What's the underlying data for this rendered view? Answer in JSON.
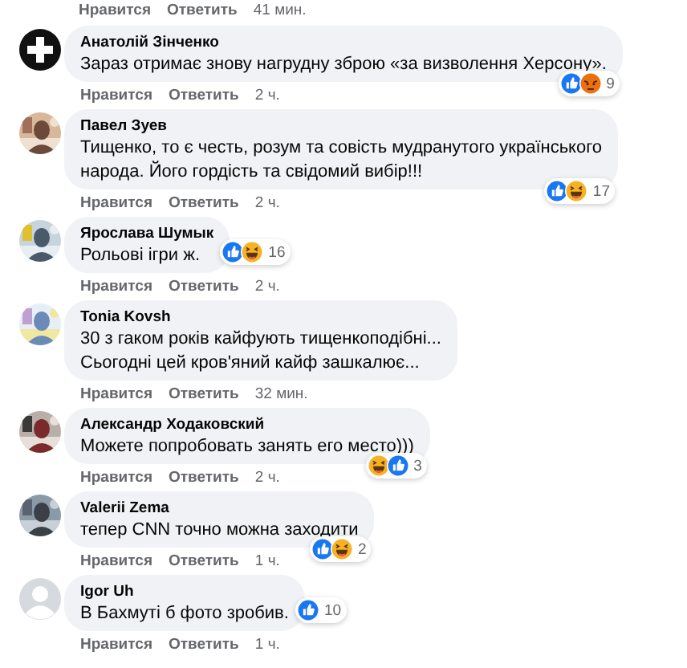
{
  "top_actions": {
    "like": "Нравится",
    "reply": "Ответить",
    "time": "41 мин."
  },
  "comments": [
    {
      "avatar": {
        "kind": "icon"
      },
      "author": "Анатолій Зінченко",
      "lines": [
        "Зараз отримає знову нагрудну зброю «за визволення Херсону»."
      ],
      "reactions": {
        "beside": false,
        "emojis": [
          {
            "kind": "like"
          },
          {
            "kind": "angry"
          }
        ],
        "count": "9"
      },
      "actions": {
        "like": "Нравится",
        "reply": "Ответить",
        "time": "2 ч."
      }
    },
    {
      "avatar": {
        "kind": "picture"
      },
      "author": "Павел Зуев",
      "lines": [
        "Тищенко, то є честь, розум та совість мудранутого українського",
        "народа. Його гордість та свідомий вибір!!!"
      ],
      "reactions": {
        "beside": false,
        "emojis": [
          {
            "kind": "like"
          },
          {
            "kind": "haha"
          }
        ],
        "count": "17"
      },
      "actions": {
        "like": "Нравится",
        "reply": "Ответить",
        "time": "2 ч."
      }
    },
    {
      "avatar": {
        "kind": "picture"
      },
      "author": "Ярослава Шумык",
      "lines": [
        "Рольові ігри ж."
      ],
      "reactions": {
        "beside": true,
        "emojis": [
          {
            "kind": "like"
          },
          {
            "kind": "haha"
          }
        ],
        "count": "16"
      },
      "actions": {
        "like": "Нравится",
        "reply": "Ответить",
        "time": "2 ч."
      }
    },
    {
      "avatar": {
        "kind": "picture"
      },
      "author": "Tonia Kovsh",
      "lines": [
        "30 з гаком років кайфують тищенкоподібні...",
        "Сьогодні цей кров'яний кайф зашкалює..."
      ],
      "actions": {
        "like": "Нравится",
        "reply": "Ответить",
        "time": "32 мин."
      }
    },
    {
      "avatar": {
        "kind": "picture"
      },
      "author": "Александр Ходаковский",
      "lines": [
        "Можете попробовать занять его место)))"
      ],
      "reactions": {
        "beside": false,
        "emojis": [
          {
            "kind": "haha"
          },
          {
            "kind": "like"
          }
        ],
        "count": "3"
      },
      "actions": {
        "like": "Нравится",
        "reply": "Ответить",
        "time": "2 ч."
      }
    },
    {
      "avatar": {
        "kind": "picture"
      },
      "author": "Valerii Zema",
      "lines": [
        "тепер CNN точно можна заходити"
      ],
      "reactions": {
        "beside": false,
        "emojis": [
          {
            "kind": "like"
          },
          {
            "kind": "haha"
          }
        ],
        "count": "2"
      },
      "actions": {
        "like": "Нравится",
        "reply": "Ответить",
        "time": "1 ч."
      }
    },
    {
      "avatar": {
        "kind": "silhouette"
      },
      "author": "Igor Uh",
      "lines": [
        "В Бахмуті б фото зробив."
      ],
      "reactions": {
        "beside": true,
        "emojis": [
          {
            "kind": "like"
          }
        ],
        "count": "10"
      },
      "actions": {
        "like": "Нравится",
        "reply": "Ответить",
        "time": "1 ч."
      }
    }
  ]
}
